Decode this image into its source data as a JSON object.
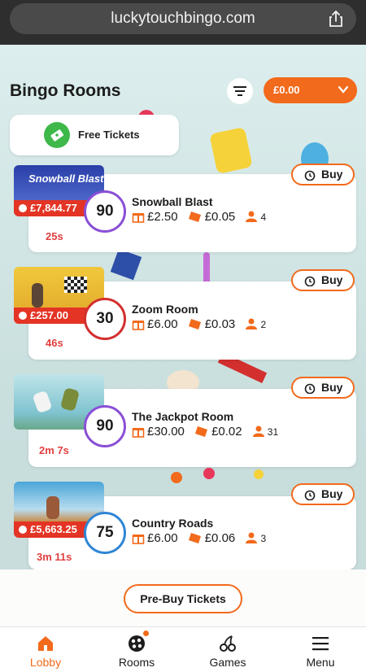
{
  "browser": {
    "url": "luckytouchbingo.com"
  },
  "header": {
    "title": "Bingo Rooms",
    "balance": "£0.00"
  },
  "free_tickets": {
    "label": "Free Tickets"
  },
  "rooms": [
    {
      "name": "Snowball Blast",
      "thumb_text": "Snowball Blast",
      "jackpot": "£7,844.77",
      "ball": "90",
      "price": "£2.50",
      "ticket_price": "£0.05",
      "players": "4",
      "timer": "25s",
      "buy_label": "Buy",
      "ball_color": "#8a4fd6"
    },
    {
      "name": "Zoom Room",
      "jackpot": "£257.00",
      "ball": "30",
      "price": "£6.00",
      "ticket_price": "£0.03",
      "players": "2",
      "timer": "46s",
      "buy_label": "Buy",
      "ball_color": "#d32f2f"
    },
    {
      "name": "The Jackpot Room",
      "jackpot": "",
      "ball": "90",
      "price": "£30.00",
      "ticket_price": "£0.02",
      "players": "31",
      "timer": "2m 7s",
      "buy_label": "Buy",
      "ball_color": "#8a4fd6"
    },
    {
      "name": "Country Roads",
      "jackpot": "£5,663.25",
      "ball": "75",
      "price": "£6.00",
      "ticket_price": "£0.06",
      "players": "3",
      "timer": "3m 11s",
      "buy_label": "Buy",
      "ball_color": "#2f86d6"
    }
  ],
  "prebuy": {
    "label": "Pre-Buy Tickets"
  },
  "nav": [
    {
      "label": "Lobby",
      "icon": "home-icon",
      "active": true
    },
    {
      "label": "Rooms",
      "icon": "bingo-balls-icon",
      "active": false
    },
    {
      "label": "Games",
      "icon": "cherries-icon",
      "active": false
    },
    {
      "label": "Menu",
      "icon": "hamburger-icon",
      "active": false
    }
  ],
  "colors": {
    "accent": "#f26a1b",
    "timer": "#e04040",
    "jackpot": "#e33425",
    "free_ticket_green": "#3fb84a"
  }
}
